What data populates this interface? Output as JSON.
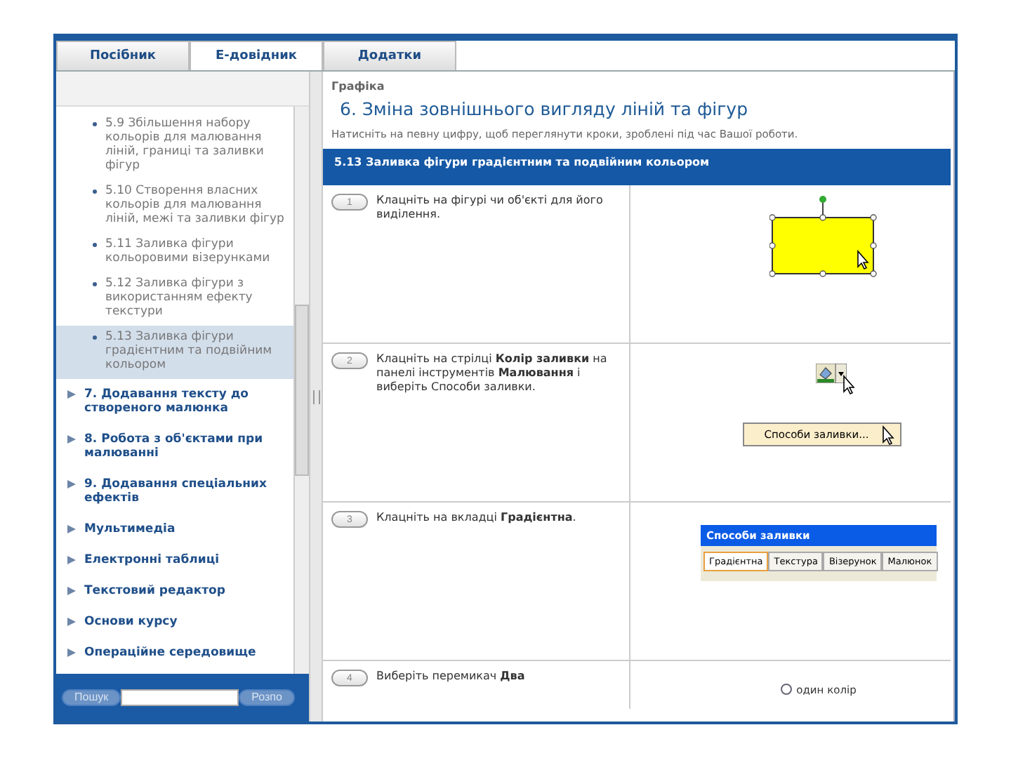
{
  "tabs": [
    {
      "label": "Посібник",
      "selected": false
    },
    {
      "label": "Е-довідник",
      "selected": true
    },
    {
      "label": "Додатки",
      "selected": false
    }
  ],
  "sidebar": {
    "tree": [
      {
        "children": [
          {
            "children": [
              {
                "label": "5.9 Збільшення набору кольорів для малювання ліній, границі та заливки фігур",
                "selected": false
              },
              {
                "label": "5.10 Створення власних кольорів для малювання ліній, межі та заливки фігур",
                "selected": false
              },
              {
                "label": "5.11 Заливка фігури кольоровими візерунками",
                "selected": false
              },
              {
                "label": "5.12 Заливка фігури з використанням ефекту текстури",
                "selected": false
              },
              {
                "label": "5.13 Заливка фігури градієнтним та подвійним кольором",
                "selected": true
              }
            ]
          },
          {
            "label": "7. Додавання тексту до створеного малюнка",
            "selected": false,
            "expanded": false
          },
          {
            "label": "8. Робота з об'єктами при малюванні",
            "selected": false,
            "expanded": false
          },
          {
            "label": "9. Додавання спеціальних ефектів",
            "selected": false,
            "expanded": false
          }
        ]
      },
      {
        "label": "Мультимедіа",
        "selected": false,
        "expanded": false
      },
      {
        "label": "Електронні таблиці",
        "selected": false,
        "expanded": false
      },
      {
        "label": "Текстовий редактор",
        "selected": false,
        "expanded": false
      },
      {
        "label": "Основи курсу",
        "selected": false,
        "expanded": false
      },
      {
        "label": "Операційне середовище",
        "selected": false,
        "expanded": false
      }
    ],
    "search": {
      "button": "Пошук",
      "go": "Розпо"
    }
  },
  "main": {
    "breadcrumb": "Графіка",
    "heading": "6. Зміна зовнішнього вигляду ліній та фігур",
    "intro": "Натисніть на певну цифру, щоб переглянути кроки, зроблені під час Вашої роботи.",
    "section": "5.13 Заливка фігури градієнтним та подвійним кольором",
    "steps": [
      {
        "number": "1",
        "text": "Клацніть на фігурі чи об'єкті для його виділення.",
        "kind": "shape"
      },
      {
        "number": "2",
        "text": "Клацніть на стрілці **Колір заливки** на панелі інструментів **Малювання** і виберіть Способи заливки.",
        "kind": "menu",
        "menu_item": "Способи заливки..."
      },
      {
        "number": "3",
        "text": "Клацніть на вкладці **Градієнтна**.",
        "kind": "dialog",
        "dialog_title": "Способи заливки",
        "tabs": [
          {
            "label": "Градієнтна",
            "selected": true
          },
          {
            "label": "Текстура",
            "selected": false
          },
          {
            "label": "Візерунок",
            "selected": false
          },
          {
            "label": "Малюнок",
            "selected": false
          }
        ]
      },
      {
        "number": "4",
        "text": "Виберіть перемикач **Два**",
        "kind": "radio",
        "radio": {
          "label": "один колір",
          "checked": false
        }
      }
    ]
  }
}
